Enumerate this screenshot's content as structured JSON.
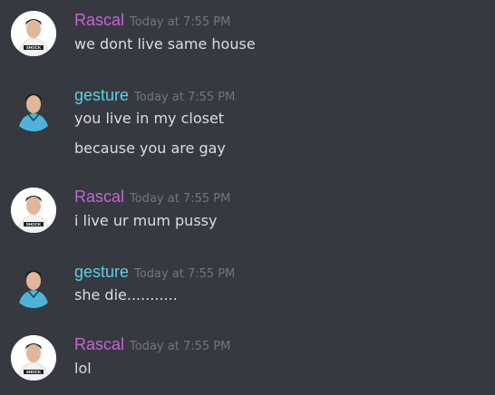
{
  "theme": {
    "background": "#36393f",
    "rascal_color": "#c763d6",
    "gesture_color": "#5bd0e8",
    "timestamp_color": "#72767d",
    "text_color": "#dcddde"
  },
  "messages": [
    {
      "author": "Rascal",
      "timestamp": "Today at 7:55 PM",
      "lines": [
        "we dont live same house"
      ],
      "avatar_icon": "player-avatar-shock"
    },
    {
      "author": "gesture",
      "timestamp": "Today at 7:55 PM",
      "lines": [
        "you live in my closet",
        "because you are gay"
      ],
      "avatar_icon": "player-avatar-fuel"
    },
    {
      "author": "Rascal",
      "timestamp": "Today at 7:55 PM",
      "lines": [
        "i live ur mum pussy"
      ],
      "avatar_icon": "player-avatar-shock"
    },
    {
      "author": "gesture",
      "timestamp": "Today at 7:55 PM",
      "lines": [
        "she die..........."
      ],
      "avatar_icon": "player-avatar-fuel"
    },
    {
      "author": "Rascal",
      "timestamp": "Today at 7:55 PM",
      "lines": [
        "lol"
      ],
      "avatar_icon": "player-avatar-shock"
    }
  ],
  "avatar_text": {
    "shock": "SHOCK"
  }
}
